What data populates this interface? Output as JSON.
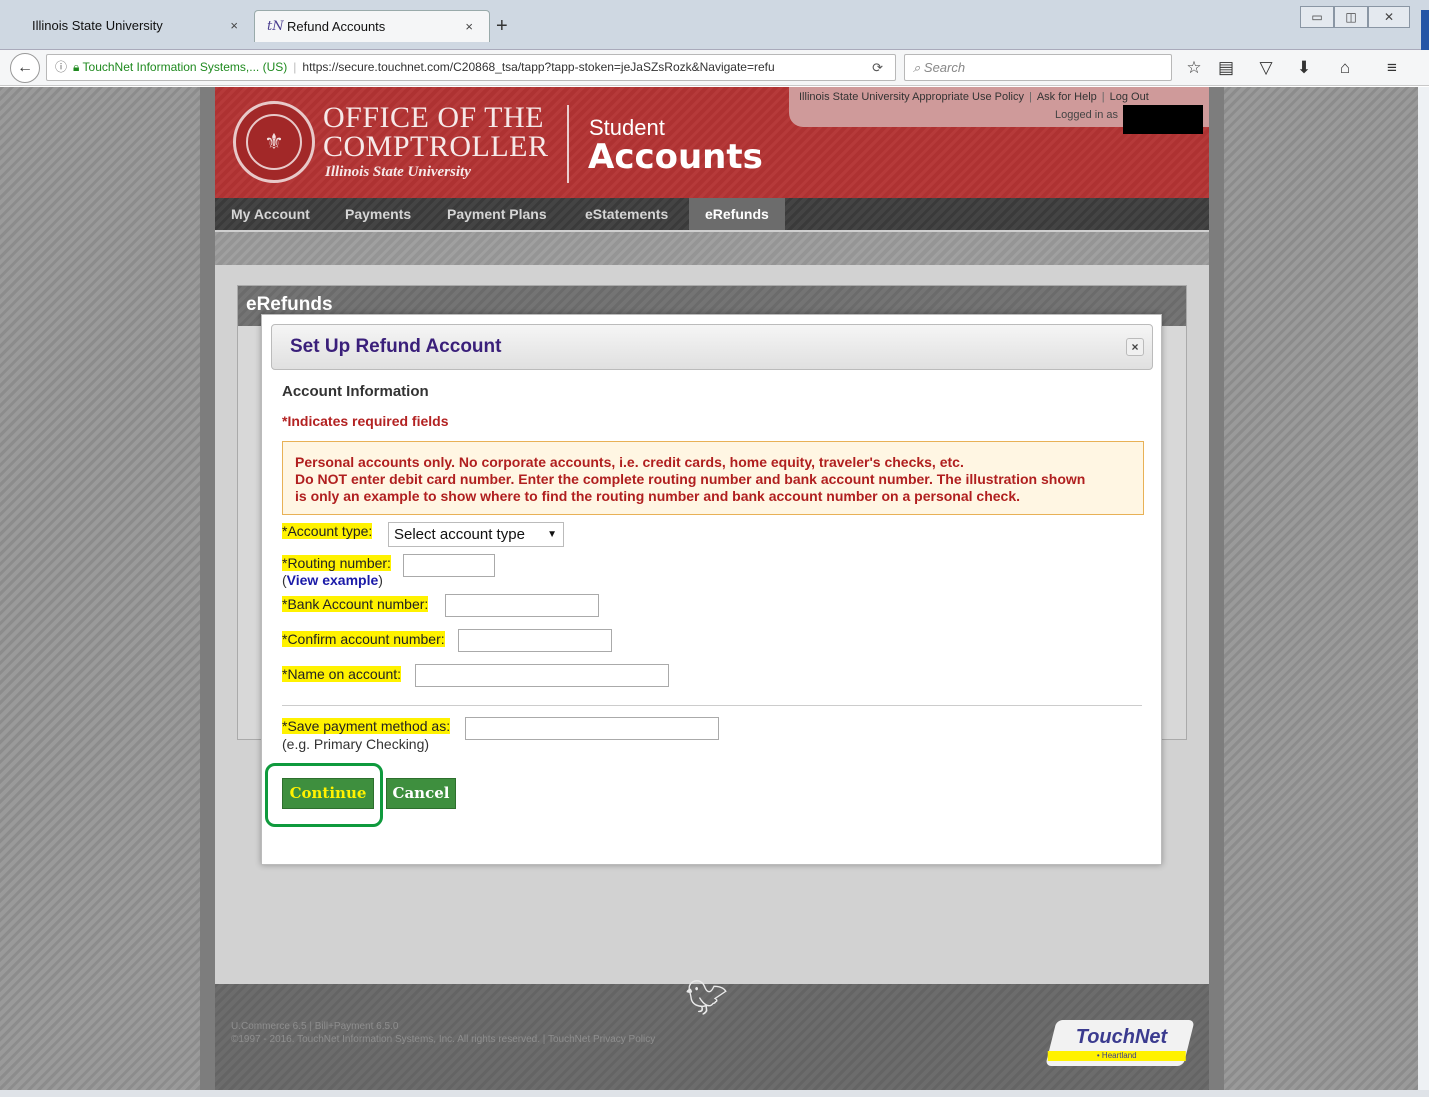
{
  "browser": {
    "tabs": [
      {
        "title": "Illinois State University",
        "close": "×"
      },
      {
        "title": "Refund Accounts",
        "close": "×",
        "favicon": "tN"
      }
    ],
    "new_tab": "+",
    "url_org": "TouchNet Information Systems,... (US)",
    "url": "https://secure.touchnet.com/C20868_tsa/tapp?tapp-stoken=jeJaSZsRozk&Navigate=refu",
    "search_placeholder": "Search"
  },
  "header": {
    "office_line1": "OFFICE OF THE",
    "office_line2": "COMPTROLLER",
    "university": "Illinois State University",
    "student": "Student",
    "accounts": "Accounts",
    "toplinks": [
      "Illinois State University Appropriate Use Policy",
      "Ask for Help",
      "Log Out"
    ],
    "logged_in": "Logged in as"
  },
  "menu": [
    "My Account",
    "Payments",
    "Payment Plans",
    "eStatements",
    "eRefunds"
  ],
  "panel_title": "eRefunds",
  "modal": {
    "title": "Set Up Refund Account",
    "close": "×",
    "section": "Account Information",
    "required_note": "*Indicates required fields",
    "notice_lines": [
      "Personal accounts only. No corporate accounts, i.e. credit cards, home equity, traveler's checks, etc.",
      "Do NOT enter debit card number. Enter the complete routing number and bank account number. The illustration shown",
      "is only an example to show where to find the routing number and bank account number on a personal check."
    ],
    "fields": {
      "account_type_label": "*Account type:",
      "account_type_value": "Select account type",
      "routing_label": "*Routing number:",
      "view_example_open": "(",
      "view_example": "View example",
      "view_example_close": ")",
      "bank_account_label": "*Bank Account number:",
      "confirm_label": "*Confirm account number:",
      "name_label": "*Name on account:",
      "save_as_label": "*Save payment method as:",
      "save_as_hint": "(e.g. Primary Checking)"
    },
    "continue": "Continue",
    "cancel": "Cancel"
  },
  "footer": {
    "line1": "U.Commerce 6.5 | Bill+Payment 6.5.0",
    "line2": "©1997 - 2016. TouchNet Information Systems, Inc. All rights reserved. | TouchNet Privacy Policy",
    "logo": "TouchNet",
    "logo_sub": "• Heartland"
  },
  "colors": {
    "banner": "#b43434",
    "accent_purple": "#3a1f7a",
    "required_red": "#b32222",
    "button_green": "#3e8f3e",
    "highlight_yellow": "#fff200"
  }
}
